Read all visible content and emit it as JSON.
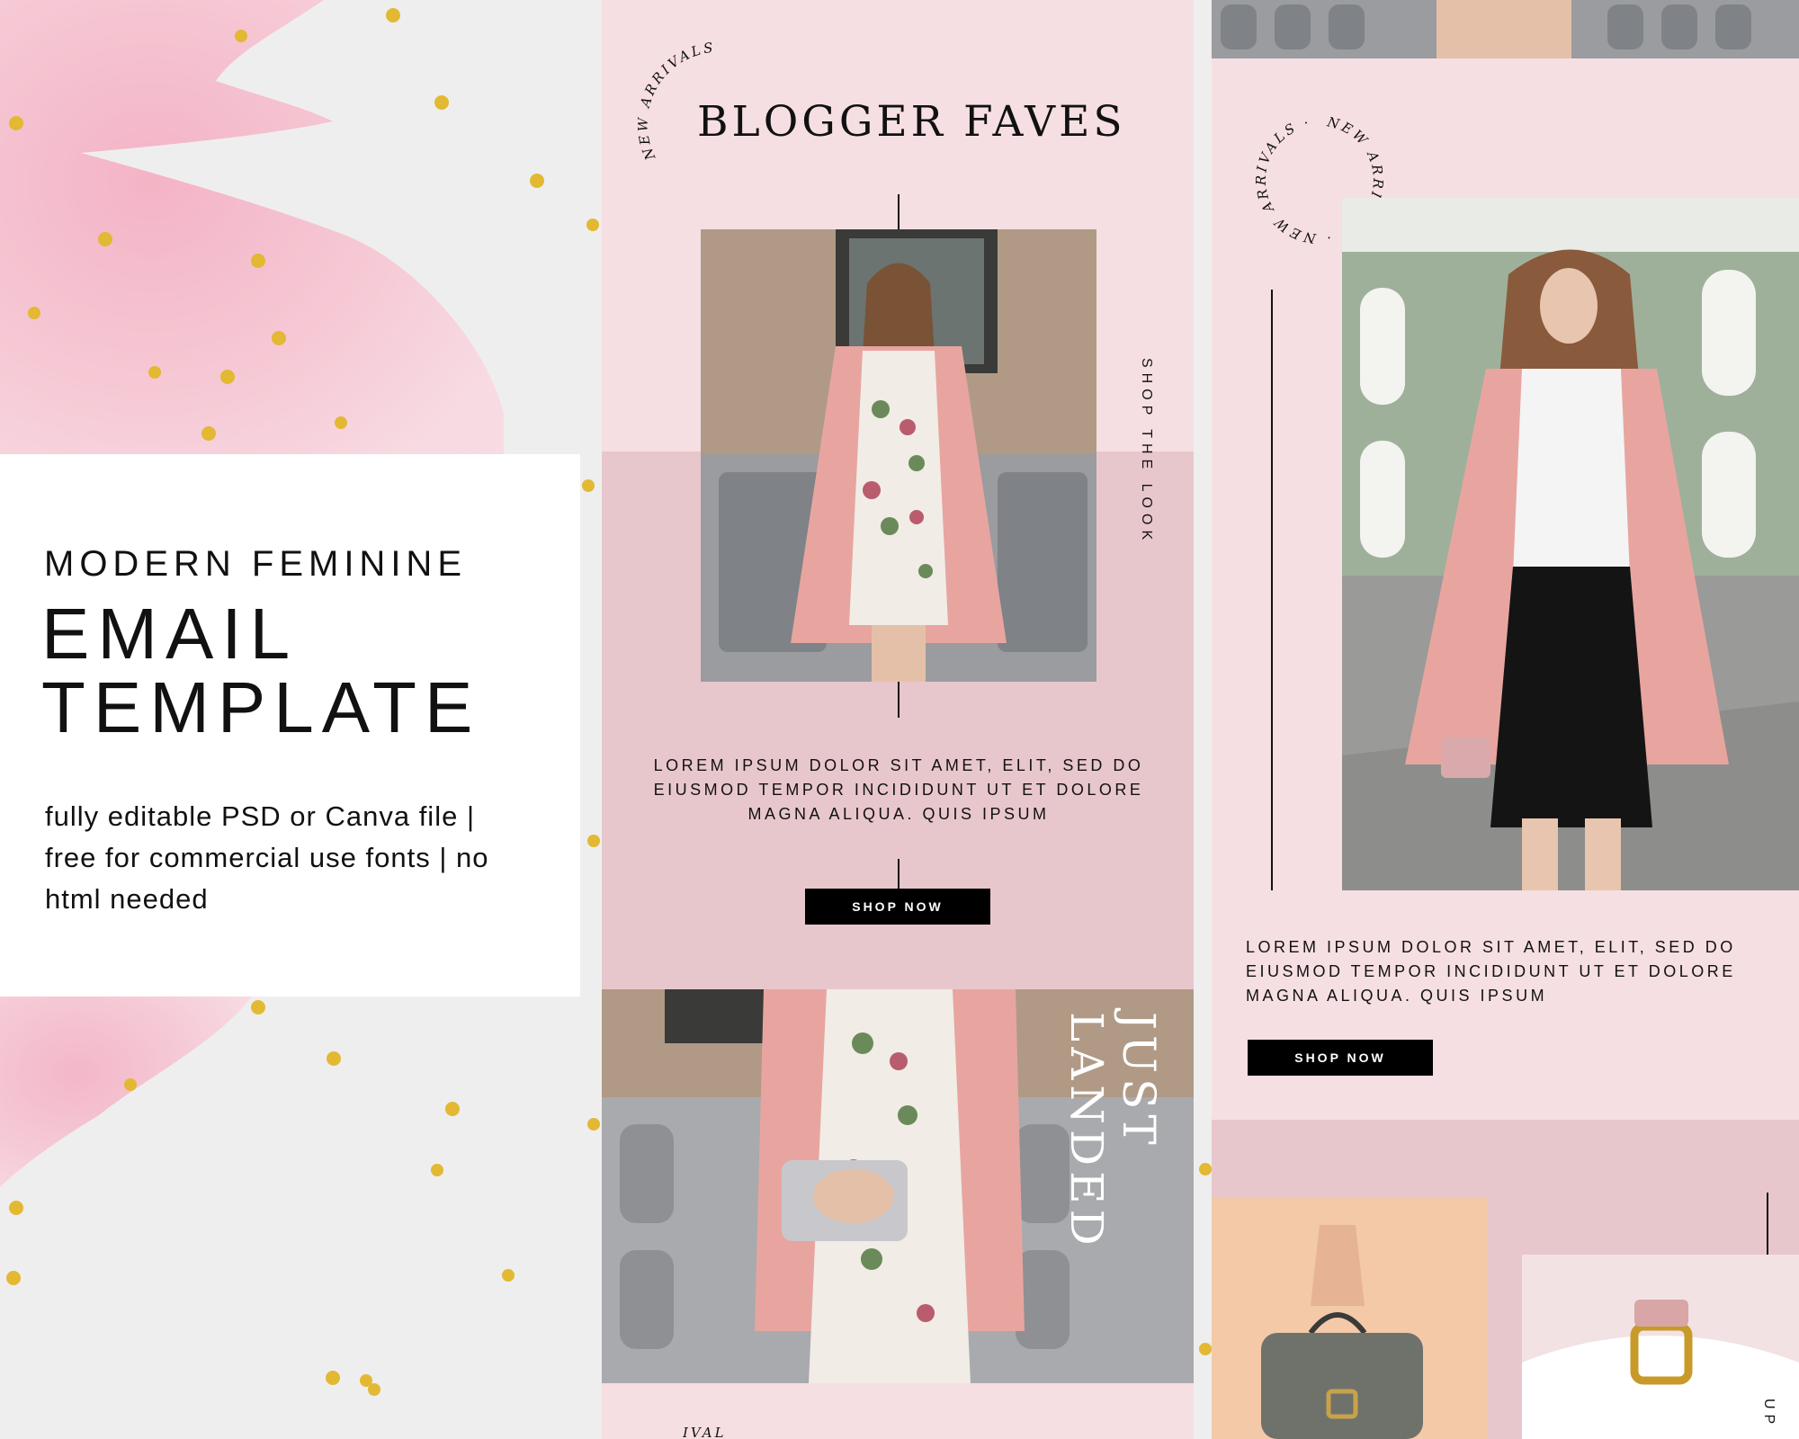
{
  "card": {
    "eyebrow": "MODERN FEMININE",
    "title_line1": "EMAIL",
    "title_line2": "TEMPLATE",
    "description": "fully editable PSD or Canva file | free for commercial use fonts | no html needed"
  },
  "email_middle": {
    "badge": "NEW ARRIVALS",
    "heading": "BLOGGER FAVES",
    "side_label": "SHOP THE LOOK",
    "body_text": "LOREM IPSUM DOLOR SIT AMET, ELIT, SED DO EIUSMOD TEMPOR INCIDIDUNT UT ET DOLORE MAGNA ALIQUA. QUIS IPSUM",
    "button_label": "SHOP NOW",
    "overlay_line1": "JUST",
    "overlay_line2": "LANDED",
    "bottom_partial": "IVAL"
  },
  "email_right": {
    "badge": "NEW ARRIVALS · NEW ARRIVALS ·",
    "body_text": "LOREM IPSUM DOLOR SIT AMET, ELIT, SED DO EIUSMOD TEMPOR INCIDIDUNT UT ET DOLORE MAGNA ALIQUA. QUIS IPSUM",
    "button_label": "SHOP NOW",
    "side_partial": "UP"
  },
  "colors": {
    "blush": "#f6dfe2",
    "dusty_rose": "#e8c7cc",
    "black": "#000000",
    "gold": "#e3b833"
  }
}
